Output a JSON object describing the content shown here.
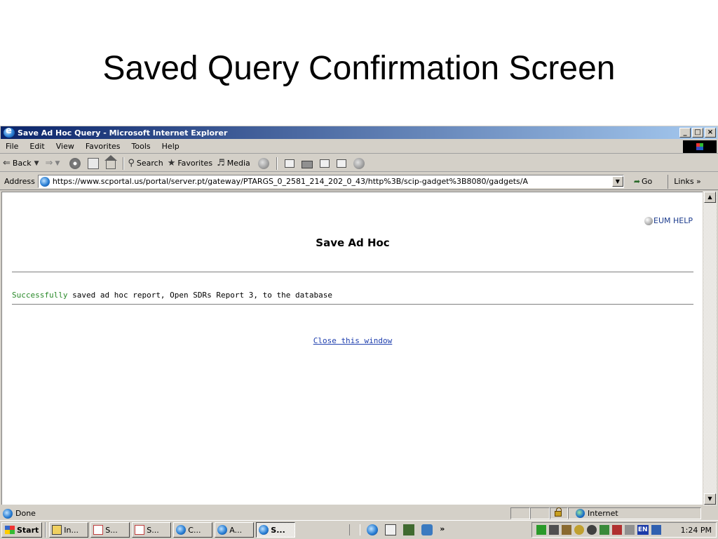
{
  "slide": {
    "title": "Saved Query Confirmation Screen"
  },
  "window": {
    "title": "Save Ad Hoc Query - Microsoft Internet Explorer",
    "controls": {
      "minimize": "_",
      "maximize": "□",
      "close": "×"
    }
  },
  "menu": {
    "items": [
      "File",
      "Edit",
      "View",
      "Favorites",
      "Tools",
      "Help"
    ]
  },
  "toolbar": {
    "back": "Back",
    "search": "Search",
    "favorites": "Favorites",
    "media": "Media"
  },
  "address": {
    "label": "Address",
    "url": "https://www.scportal.us/portal/server.pt/gateway/PTARGS_0_2581_214_202_0_43/http%3B/scip-gadget%3B8080/gadgets/A",
    "go": "Go",
    "links": "Links »"
  },
  "page": {
    "help": "EUM HELP",
    "heading": "Save Ad Hoc",
    "message_status": "Successfully",
    "message_rest": " saved ad hoc report, Open SDRs Report 3, to the database",
    "close_link": "Close this window"
  },
  "statusbar": {
    "text": "Done",
    "zone": "Internet"
  },
  "taskbar": {
    "start": "Start",
    "tasks": [
      "In...",
      "S...",
      "S...",
      "C...",
      "A...",
      "S..."
    ],
    "tray_lang": "EN",
    "clock": "1:24 PM"
  },
  "colors": {
    "titlebar_start": "#0a246a",
    "titlebar_end": "#a6caf0",
    "chrome": "#d4d0c8",
    "success_text": "#2a8a2a",
    "link": "#1f3fae"
  }
}
